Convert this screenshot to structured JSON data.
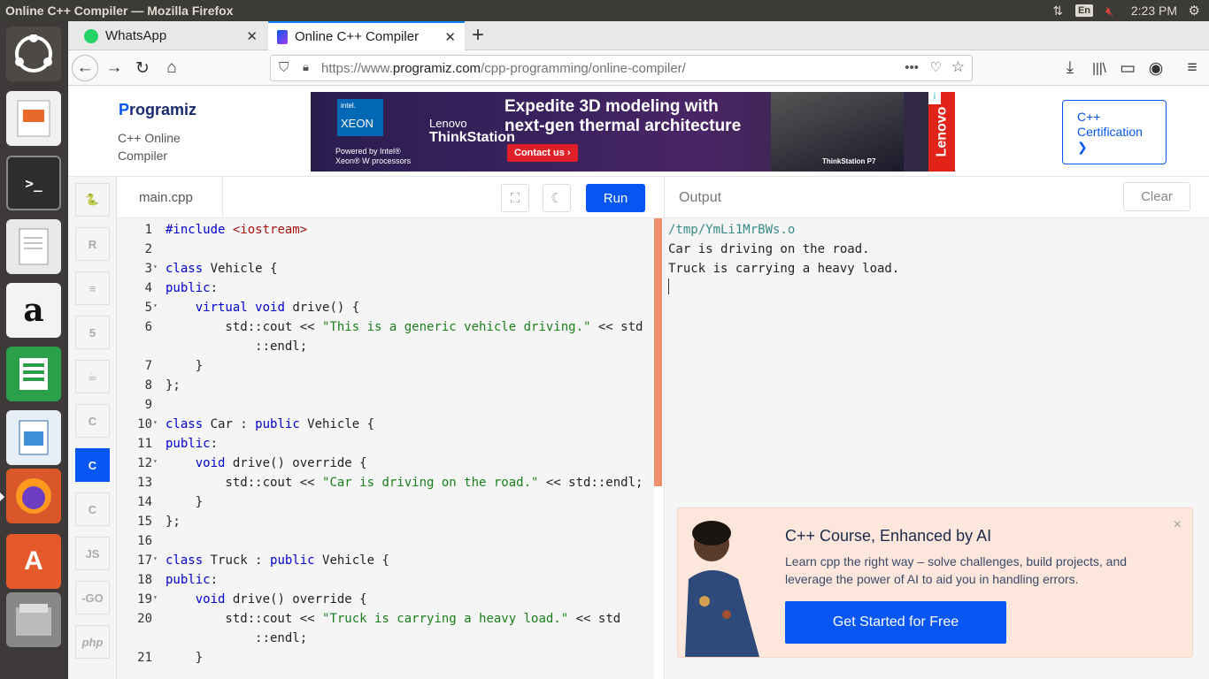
{
  "os": {
    "window_title": "Online C++ Compiler — Mozilla Firefox",
    "keyboard_layout": "En",
    "clock": "2:23 PM"
  },
  "launcher": [
    "ubuntu-logo-icon",
    "impress-icon",
    "terminal-icon",
    "text-editor-icon",
    "amazon-icon",
    "calc-icon",
    "writer-icon",
    "firefox-icon",
    "software-center-icon",
    "files-icon"
  ],
  "browser": {
    "tabs": [
      {
        "title": "WhatsApp",
        "active": false
      },
      {
        "title": "Online C++ Compiler",
        "active": true
      }
    ],
    "url_prefix": "https://www.",
    "url_domain": "programiz.com",
    "url_path": "/cpp-programming/online-compiler/"
  },
  "header": {
    "logo_text": "rogramiz",
    "logo_mark": "P",
    "subtitle_line1": "C++ Online",
    "subtitle_line2": "Compiler",
    "ad": {
      "intel_brand": "intel.",
      "xeon_label": "XEON",
      "powered_by_1": "Powered by Intel®",
      "powered_by_2": "Xeon® W processors",
      "lenovo_label": "Lenovo",
      "thinkstation_label": "ThinkStation",
      "headline_1": "Expedite 3D modeling with",
      "headline_2": "next-gen thermal architecture",
      "cta": "Contact us ›",
      "product_caption": "ThinkStation P7",
      "side_brand": "Lenovo"
    },
    "certification_line1": "C++",
    "certification_line2": "Certification",
    "certification_arrow": "❯"
  },
  "sidebar_langs": [
    {
      "name": "python",
      "label": "🐍"
    },
    {
      "name": "r",
      "label": "R"
    },
    {
      "name": "sql",
      "label": "≡"
    },
    {
      "name": "html",
      "label": "5"
    },
    {
      "name": "java",
      "label": "☕"
    },
    {
      "name": "c",
      "label": "C"
    },
    {
      "name": "cpp",
      "label": "C"
    },
    {
      "name": "csharp",
      "label": "C"
    },
    {
      "name": "js",
      "label": "JS"
    },
    {
      "name": "go",
      "label": "-GO"
    },
    {
      "name": "php",
      "label": "php"
    }
  ],
  "editor": {
    "file_tab": "main.cpp",
    "run_label": "Run",
    "lines": [
      {
        "n": "1",
        "html": "<span class='kw'>#include</span> <span class='inc'>&lt;iostream&gt;</span>"
      },
      {
        "n": "2",
        "html": ""
      },
      {
        "n": "3",
        "fold": true,
        "html": "<span class='kw'>class</span> Vehicle {"
      },
      {
        "n": "4",
        "html": "<span class='kw'>public</span>:"
      },
      {
        "n": "5",
        "fold": true,
        "html": "    <span class='kw'>virtual</span> <span class='kw'>void</span> drive() {"
      },
      {
        "n": "6",
        "html": "        std::cout &lt;&lt; <span class='st'>\"This is a generic vehicle driving.\"</span> &lt;&lt; std"
      },
      {
        "n": "",
        "html": "            ::endl;"
      },
      {
        "n": "7",
        "html": "    }"
      },
      {
        "n": "8",
        "html": "};"
      },
      {
        "n": "9",
        "html": ""
      },
      {
        "n": "10",
        "fold": true,
        "html": "<span class='kw'>class</span> Car : <span class='kw'>public</span> Vehicle {"
      },
      {
        "n": "11",
        "html": "<span class='kw'>public</span>:"
      },
      {
        "n": "12",
        "fold": true,
        "html": "    <span class='kw'>void</span> drive() override {"
      },
      {
        "n": "13",
        "html": "        std::cout &lt;&lt; <span class='st'>\"Car is driving on the road.\"</span> &lt;&lt; std::endl;"
      },
      {
        "n": "14",
        "html": "    }"
      },
      {
        "n": "15",
        "html": "};"
      },
      {
        "n": "16",
        "html": ""
      },
      {
        "n": "17",
        "fold": true,
        "html": "<span class='kw'>class</span> Truck : <span class='kw'>public</span> Vehicle {"
      },
      {
        "n": "18",
        "html": "<span class='kw'>public</span>:"
      },
      {
        "n": "19",
        "fold": true,
        "html": "    <span class='kw'>void</span> drive() override {"
      },
      {
        "n": "20",
        "html": "        std::cout &lt;&lt; <span class='st'>\"Truck is carrying a heavy load.\"</span> &lt;&lt; std"
      },
      {
        "n": "",
        "html": "            ::endl;"
      },
      {
        "n": "21",
        "html": "    }"
      }
    ]
  },
  "output": {
    "title": "Output",
    "clear_label": "Clear",
    "lines": [
      "/tmp/YmLi1MrBWs.o",
      "Car is driving on the road.",
      "Truck is carrying a heavy load."
    ]
  },
  "promo": {
    "title": "C++ Course, Enhanced by AI",
    "text": "Learn cpp the right way – solve challenges, build projects, and leverage the power of AI to aid you in handling errors.",
    "button": "Get Started for Free",
    "close": "×"
  }
}
